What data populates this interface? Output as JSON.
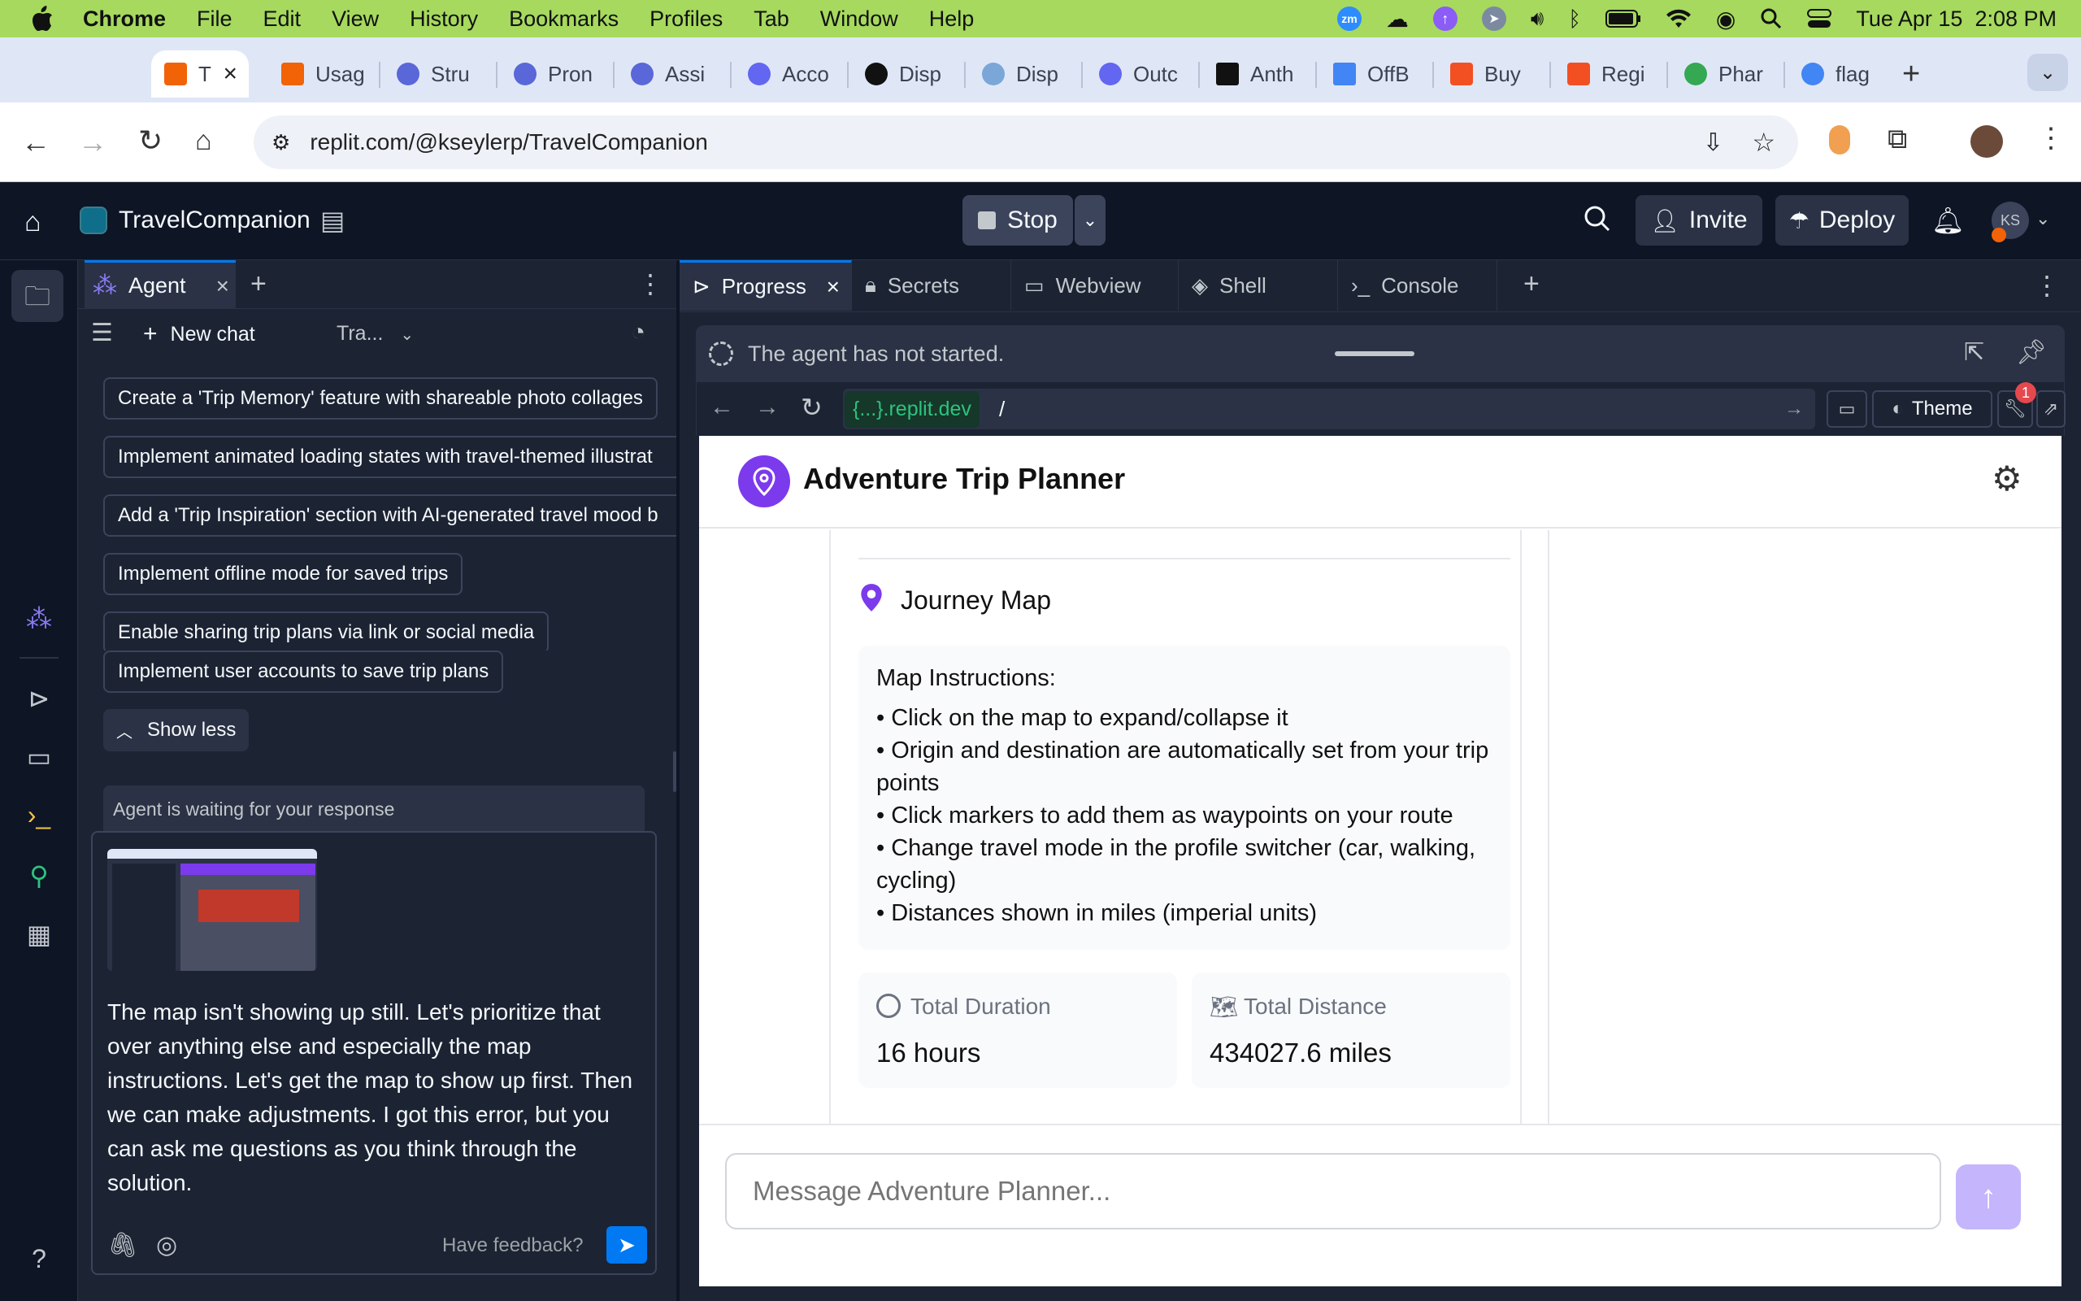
{
  "mac_menu": {
    "app": "Chrome",
    "items": [
      "File",
      "Edit",
      "View",
      "History",
      "Bookmarks",
      "Profiles",
      "Tab",
      "Window",
      "Help"
    ],
    "datetime": "Tue Apr 15  2:08 PM"
  },
  "browser": {
    "active_tab": "T",
    "tabs": [
      {
        "label": "Usag",
        "color": "#f26207"
      },
      {
        "label": "Stru",
        "color": "#5a67d8"
      },
      {
        "label": "Pron",
        "color": "#5a67d8"
      },
      {
        "label": "Assi",
        "color": "#5a67d8"
      },
      {
        "label": "Acco",
        "color": "#6366f1"
      },
      {
        "label": "Disp",
        "color": "#111111"
      },
      {
        "label": "Disp",
        "color": "#7aa7d8"
      },
      {
        "label": "Outc",
        "color": "#6366f1"
      },
      {
        "label": "Anth",
        "color": "#111111"
      },
      {
        "label": "OffB",
        "color": "#4285f4"
      },
      {
        "label": "Buy",
        "color": "#f25022"
      },
      {
        "label": "Regi",
        "color": "#f25022"
      },
      {
        "label": "Phar",
        "color": "#34a853"
      },
      {
        "label": "flag",
        "color": "#4285f4"
      }
    ],
    "url": "replit.com/@kseylerp/TravelCompanion"
  },
  "replit": {
    "project_name": "TravelCompanion",
    "stop_label": "Stop",
    "invite_label": "Invite",
    "deploy_label": "Deploy",
    "avatar_initials": "KS"
  },
  "agent": {
    "tab_label": "Agent",
    "new_chat_label": "New chat",
    "chat_selector": "Tra...",
    "suggestions": [
      "Create a 'Trip Memory' feature with shareable photo collages",
      "Implement animated loading states with travel-themed illustrat",
      "Add a 'Trip Inspiration' section with AI-generated travel mood b",
      "Implement offline mode for saved trips",
      "Enable sharing trip plans via link or social media",
      "Implement user accounts to save trip plans"
    ],
    "show_less_label": "Show less",
    "waiting_text": "Agent is waiting for your response",
    "message_text": "The map isn't showing up still. Let's prioritize that over anything else and especially the map instructions. Let's get the map to show up first. Then we can make adjustments. I got this error, but you can ask me questions as you think through the solution.",
    "feedback_label": "Have feedback?"
  },
  "tools": {
    "tabs": [
      "Progress",
      "Secrets",
      "Webview",
      "Shell",
      "Console"
    ],
    "status_text": "The agent has not started.",
    "domain_text": "{...}.replit.dev",
    "path_text": "/",
    "theme_label": "Theme",
    "notification_count": "1"
  },
  "webapp": {
    "title": "Adventure Trip Planner",
    "journey_title": "Journey Map",
    "instructions_title": "Map Instructions:",
    "instructions": [
      "• Click on the map to expand/collapse it",
      "• Origin and destination are automatically set from your trip points",
      "• Click markers to add them as waypoints on your route",
      "• Change travel mode in the profile switcher (car, walking, cycling)",
      "• Distances shown in miles (imperial units)"
    ],
    "duration_label": "Total Duration",
    "duration_value": "16 hours",
    "distance_label": "Total Distance",
    "distance_value": "434027.6 miles",
    "message_placeholder": "Message Adventure Planner..."
  },
  "colors": {
    "mac_menubar": "#a6d95e",
    "replit_bg": "#0e1525",
    "panel_bg": "#1c2333",
    "accent_purple": "#7c3aed",
    "send_blue": "#0079f2"
  }
}
